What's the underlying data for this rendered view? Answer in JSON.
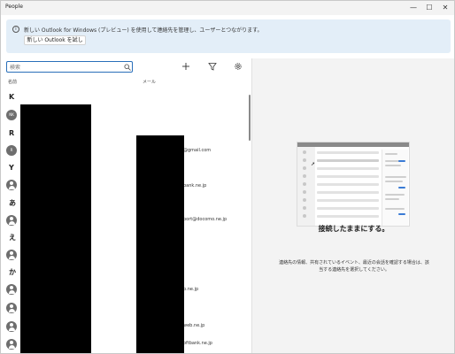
{
  "window": {
    "title": "People"
  },
  "title_controls": {
    "minimize": "—",
    "maximize": "☐",
    "close": "✕"
  },
  "banner": {
    "icon_glyph": "i",
    "text": "新しい Outlook for Windows (プレビュー) を使用して連絡先を管理し、ユーザーとつながります。",
    "button_label": "新しい Outlook を試して"
  },
  "toolbar": {
    "search_placeholder": "検索",
    "search_value": ""
  },
  "list": {
    "columns": {
      "name": "名前",
      "email": "メール"
    },
    "groups": [
      {
        "letter": "K",
        "avatar": "NK"
      },
      {
        "letter": "R",
        "avatar": "R"
      },
      {
        "letter": "Y",
        "avatar": ""
      },
      {
        "letter": "あ",
        "avatar": ""
      },
      {
        "letter": "え",
        "avatar": ""
      },
      {
        "letter": "か",
        "avatar": ""
      }
    ],
    "extra_avatars": [
      "",
      "",
      ""
    ],
    "emails": [
      "@gmail.com",
      "bank.ne.jp",
      "port@docomo.ne.jp",
      "b.ne.jp",
      "web.ne.jp",
      "oftbank.ne.jp"
    ]
  },
  "right_pane": {
    "title": "接続したままにする。",
    "description": "連絡先の情報、共有されているイベント、最近の会話を確認する場合は、該当する連絡先を選択してください。"
  },
  "icons": {
    "search": "search-icon",
    "add": "plus-icon",
    "filter": "filter-icon",
    "settings": "gear-icon",
    "person": "person-icon",
    "info": "info-icon"
  }
}
